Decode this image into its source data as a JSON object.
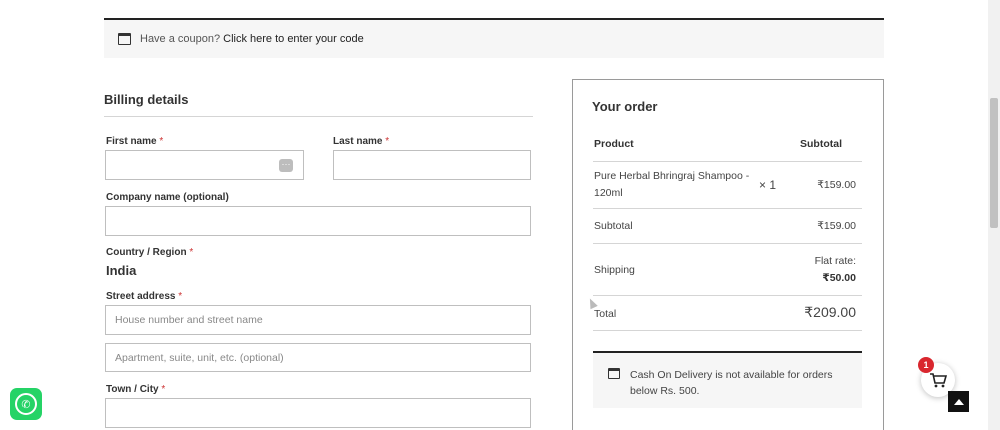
{
  "coupon": {
    "question": "Have a coupon?",
    "link": "Click here to enter your code"
  },
  "billing": {
    "title": "Billing details",
    "first_name_label": "First name",
    "last_name_label": "Last name",
    "company_label": "Company name (optional)",
    "country_label": "Country / Region",
    "country_value": "India",
    "street_label": "Street address",
    "street_placeholder": "House number and street name",
    "street2_placeholder": "Apartment, suite, unit, etc. (optional)",
    "city_label": "Town / City",
    "required_mark": "*"
  },
  "order": {
    "title": "Your order",
    "col_product": "Product",
    "col_subtotal": "Subtotal",
    "item_name_line1": "Pure Herbal Bhringraj Shampoo -",
    "item_name_line2": "120ml",
    "item_qty": "× 1",
    "item_price": "₹159.00",
    "subtotal_label": "Subtotal",
    "subtotal_value": "₹159.00",
    "shipping_label": "Shipping",
    "shipping_method": "Flat rate:",
    "shipping_value": "₹50.00",
    "total_label": "Total",
    "total_value": "₹209.00",
    "cod_line1": "Cash On Delivery is not available for orders",
    "cod_line2": "below Rs. 500."
  },
  "cart": {
    "count": "1"
  },
  "colors": {
    "badge": "#d9272e",
    "whatsapp": "#25d366"
  }
}
